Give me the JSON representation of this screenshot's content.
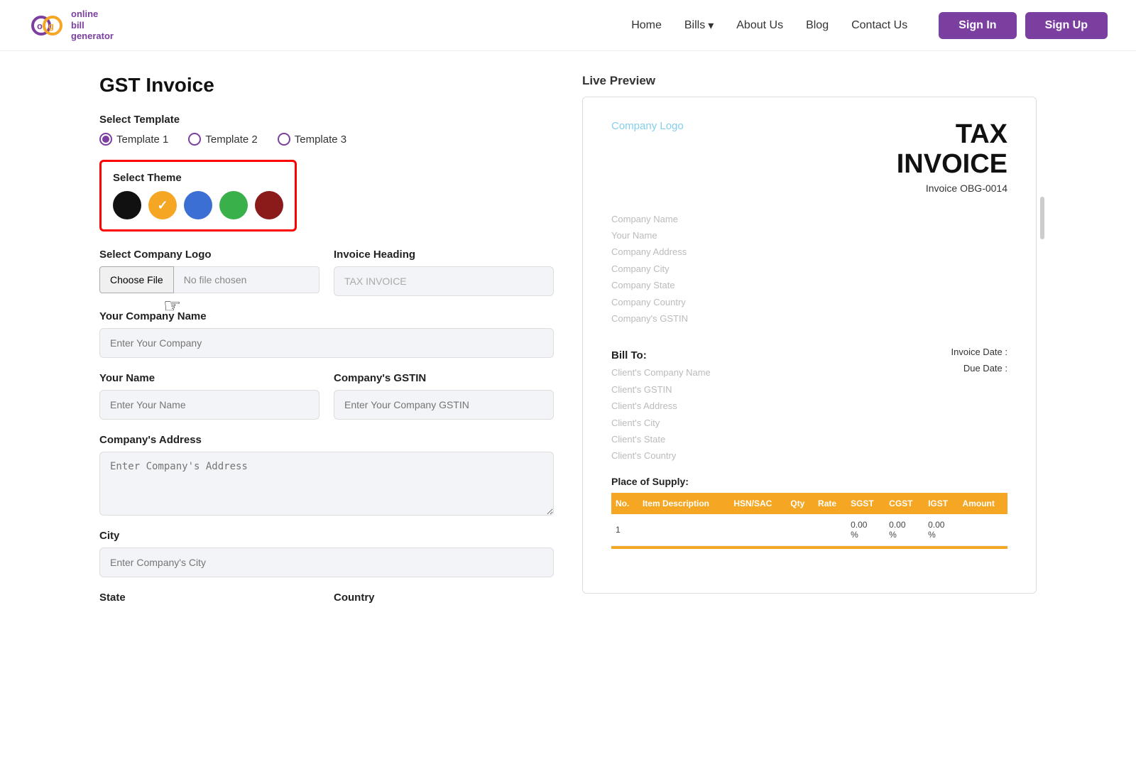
{
  "brand": {
    "logo_letters": "og",
    "logo_sub": "online\nbill\ngenerator"
  },
  "navbar": {
    "home": "Home",
    "bills": "Bills",
    "about": "About Us",
    "blog": "Blog",
    "contact": "Contact Us",
    "signin": "Sign In",
    "signup": "Sign Up"
  },
  "page": {
    "title": "GST Invoice"
  },
  "template": {
    "label": "Select Template",
    "options": [
      "Template 1",
      "Template 2",
      "Template 3"
    ]
  },
  "theme": {
    "label": "Select Theme",
    "colors": [
      {
        "name": "black",
        "hex": "#111111"
      },
      {
        "name": "orange",
        "hex": "#f5a623",
        "selected": true
      },
      {
        "name": "blue",
        "hex": "#3b6fd4"
      },
      {
        "name": "green",
        "hex": "#3ab04a"
      },
      {
        "name": "dark-red",
        "hex": "#8b1a1a"
      }
    ]
  },
  "form": {
    "logo_label": "Select Company Logo",
    "choose_file": "Choose File",
    "no_file": "No file chosen",
    "invoice_heading_label": "Invoice Heading",
    "invoice_heading_value": "TAX INVOICE",
    "company_name_label": "Your Company Name",
    "company_name_placeholder": "Enter Your Company",
    "your_name_label": "Your Name",
    "your_name_placeholder": "Enter Your Name",
    "gstin_label": "Company's GSTIN",
    "gstin_placeholder": "Enter Your Company GSTIN",
    "address_label": "Company's Address",
    "address_placeholder": "Enter Company's Address",
    "city_label": "City",
    "city_placeholder": "Enter Company's City",
    "state_label": "State",
    "country_label": "Country"
  },
  "preview": {
    "label": "Live Preview",
    "logo_placeholder": "Company Logo",
    "invoice_title_line1": "TAX",
    "invoice_title_line2": "INVOICE",
    "invoice_number": "Invoice OBG-0014",
    "company_fields": [
      "Company Name",
      "Your Name",
      "Company Address",
      "Company City",
      "Company State",
      "Company Country",
      "Company's GSTIN"
    ],
    "bill_to": "Bill To:",
    "client_fields": [
      "Client's Company Name",
      "Client's GSTIN",
      "Client's Address",
      "Client's City",
      "Client's State",
      "Client's Country"
    ],
    "invoice_date_label": "Invoice Date :",
    "due_date_label": "Due Date :",
    "place_of_supply": "Place of Supply:",
    "table_headers": [
      "No.",
      "Item Description",
      "HSN/SAC",
      "Qty",
      "Rate",
      "SGST",
      "CGST",
      "IGST",
      "Amount"
    ],
    "table_row": {
      "no": "1",
      "sgst": "0.00\n%",
      "cgst": "0.00\n%",
      "igst": "0.00\n%"
    }
  }
}
